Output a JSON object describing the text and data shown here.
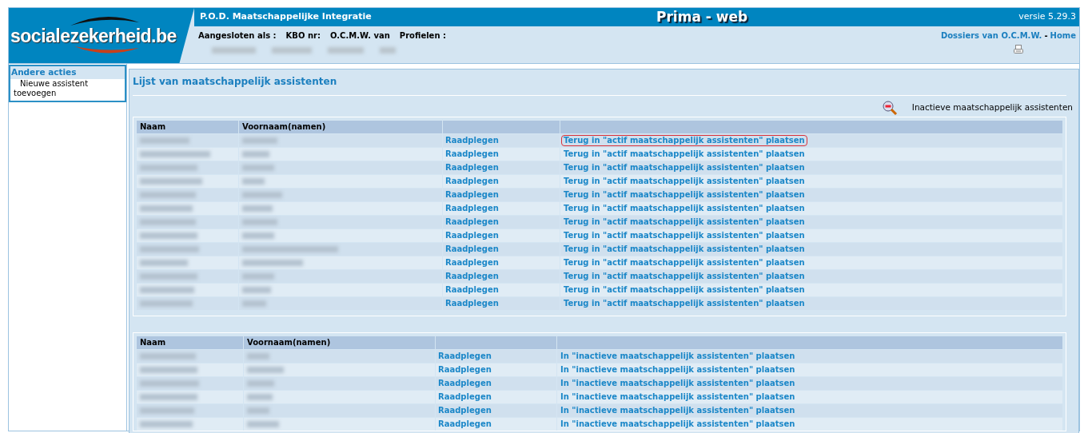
{
  "header": {
    "ministry": "P.O.D. Maatschappelijke Integratie",
    "app_title": "Prima - web",
    "version": "versie 5.29.3",
    "logo": "socialezekerheid.be",
    "info_labels": [
      "Aangesloten als :",
      "KBO nr:",
      "O.C.M.W. van",
      "Profielen :"
    ],
    "links": [
      {
        "label": "Dossiers van O.C.M.W."
      },
      {
        "label": "Home"
      }
    ],
    "separator": "-"
  },
  "sidebar": {
    "title": "Andere acties",
    "items": [
      "Nieuwe assistent toevoegen"
    ]
  },
  "page_title": "Lijst van maatschappelijk assistenten",
  "toolbar": {
    "label": "Inactieve maatschappelijk assistenten"
  },
  "tables": [
    {
      "columns": [
        "Naam",
        "Voornaam(namen)"
      ],
      "rows": [
        {
          "view": "Raadplegen",
          "action": "Terug in \"actif maatschappelijk assistenten\" plaatsen",
          "highlighted": true
        },
        {
          "view": "Raadplegen",
          "action": "Terug in \"actif maatschappelijk assistenten\" plaatsen",
          "highlighted": false
        },
        {
          "view": "Raadplegen",
          "action": "Terug in \"actif maatschappelijk assistenten\" plaatsen",
          "highlighted": false
        },
        {
          "view": "Raadplegen",
          "action": "Terug in \"actif maatschappelijk assistenten\" plaatsen",
          "highlighted": false
        },
        {
          "view": "Raadplegen",
          "action": "Terug in \"actif maatschappelijk assistenten\" plaatsen",
          "highlighted": false
        },
        {
          "view": "Raadplegen",
          "action": "Terug in \"actif maatschappelijk assistenten\" plaatsen",
          "highlighted": false
        },
        {
          "view": "Raadplegen",
          "action": "Terug in \"actif maatschappelijk assistenten\" plaatsen",
          "highlighted": false
        },
        {
          "view": "Raadplegen",
          "action": "Terug in \"actif maatschappelijk assistenten\" plaatsen",
          "highlighted": false
        },
        {
          "view": "Raadplegen",
          "action": "Terug in \"actif maatschappelijk assistenten\" plaatsen",
          "highlighted": false
        },
        {
          "view": "Raadplegen",
          "action": "Terug in \"actif maatschappelijk assistenten\" plaatsen",
          "highlighted": false
        },
        {
          "view": "Raadplegen",
          "action": "Terug in \"actif maatschappelijk assistenten\" plaatsen",
          "highlighted": false
        },
        {
          "view": "Raadplegen",
          "action": "Terug in \"actif maatschappelijk assistenten\" plaatsen",
          "highlighted": false
        },
        {
          "view": "Raadplegen",
          "action": "Terug in \"actif maatschappelijk assistenten\" plaatsen",
          "highlighted": false
        }
      ]
    },
    {
      "columns": [
        "Naam",
        "Voornaam(namen)"
      ],
      "rows": [
        {
          "view": "Raadplegen",
          "action": "In \"inactieve maatschappelijk assistenten\" plaatsen",
          "highlighted": false
        },
        {
          "view": "Raadplegen",
          "action": "In \"inactieve maatschappelijk assistenten\" plaatsen",
          "highlighted": false
        },
        {
          "view": "Raadplegen",
          "action": "In \"inactieve maatschappelijk assistenten\" plaatsen",
          "highlighted": false
        },
        {
          "view": "Raadplegen",
          "action": "In \"inactieve maatschappelijk assistenten\" plaatsen",
          "highlighted": false
        },
        {
          "view": "Raadplegen",
          "action": "In \"inactieve maatschappelijk assistenten\" plaatsen",
          "highlighted": false
        },
        {
          "view": "Raadplegen",
          "action": "In \"inactieve maatschappelijk assistenten\" plaatsen",
          "highlighted": false
        }
      ]
    }
  ]
}
